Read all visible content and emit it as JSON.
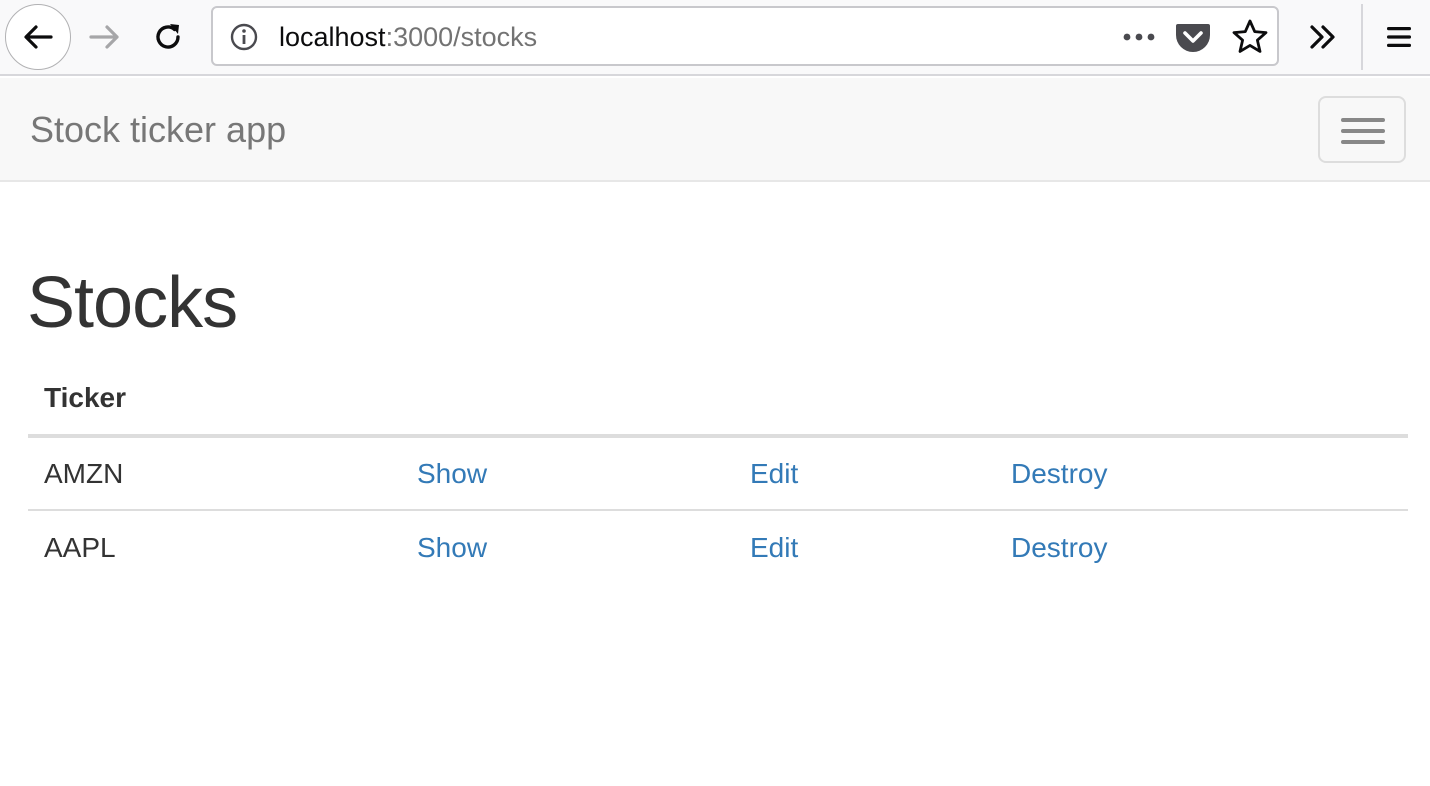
{
  "browser": {
    "url_host": "localhost",
    "url_rest": ":3000/stocks"
  },
  "navbar": {
    "brand": "Stock ticker app"
  },
  "page": {
    "title": "Stocks"
  },
  "table": {
    "headers": [
      "Ticker",
      "",
      "",
      ""
    ],
    "rows": [
      {
        "ticker": "AMZN",
        "show": "Show",
        "edit": "Edit",
        "destroy": "Destroy"
      },
      {
        "ticker": "AAPL",
        "show": "Show",
        "edit": "Edit",
        "destroy": "Destroy"
      }
    ]
  },
  "colors": {
    "link": "#337ab7",
    "text": "#333333",
    "navbar_bg": "#f8f8f8",
    "brand": "#777777"
  },
  "icons": {
    "back": "back-arrow-icon",
    "forward": "forward-arrow-icon",
    "reload": "reload-icon",
    "info": "info-icon",
    "page_actions": "more-horizontal-icon",
    "pocket": "pocket-icon",
    "bookmark": "star-icon",
    "overflow": "chevron-double-right-icon",
    "menu": "hamburger-menu-icon"
  }
}
